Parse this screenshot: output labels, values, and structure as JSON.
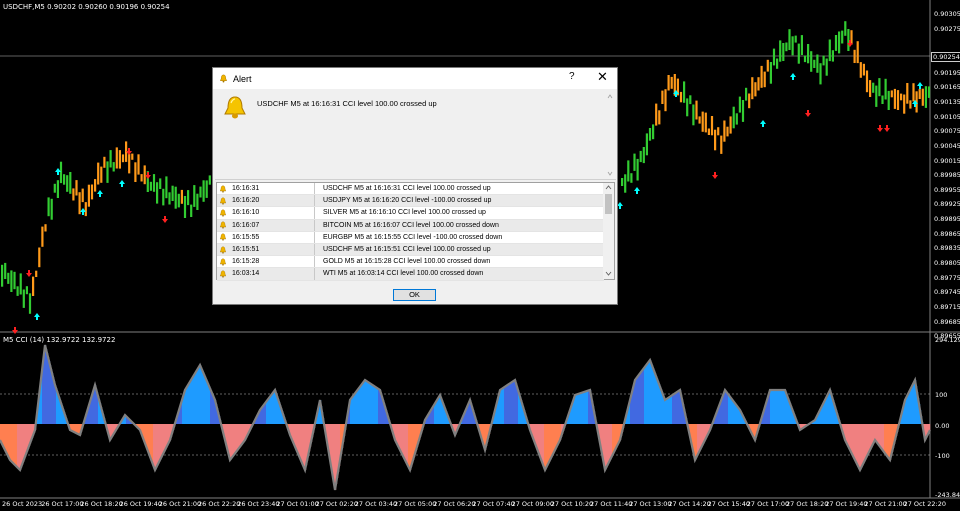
{
  "chart": {
    "symbol_header": "USDCHF,M5  0.90202 0.90260 0.90196 0.90254",
    "current_price": "0.90254",
    "price_ticks": [
      "0.90305",
      "0.90275",
      "0.90254",
      "0.90225",
      "0.90195",
      "0.90165",
      "0.90135",
      "0.90105",
      "0.90075",
      "0.90045",
      "0.90015",
      "0.89985",
      "0.89955",
      "0.89925",
      "0.89895",
      "0.89865",
      "0.89835",
      "0.89805",
      "0.89775",
      "0.89745",
      "0.89715",
      "0.89685",
      "0.89655"
    ],
    "indicator_header": "M5 CCI (14) 132.9722 132.9722",
    "cci_ticks": [
      "294.1291",
      "100",
      "0.00",
      "-100",
      "-243.843"
    ],
    "time_ticks": [
      "26 Oct 2023",
      "26 Oct 17:00",
      "26 Oct 18:20",
      "26 Oct 19:40",
      "26 Oct 21:00",
      "26 Oct 22:20",
      "26 Oct 23:40",
      "27 Oct 01:00",
      "27 Oct 02:20",
      "27 Oct 03:40",
      "27 Oct 05:00",
      "27 Oct 06:20",
      "27 Oct 07:40",
      "27 Oct 09:00",
      "27 Oct 10:20",
      "27 Oct 11:40",
      "27 Oct 13:00",
      "27 Oct 14:20",
      "27 Oct 15:40",
      "27 Oct 17:00",
      "27 Oct 18:20",
      "27 Oct 19:40",
      "27 Oct 21:00",
      "27 Oct 22:20"
    ],
    "colors": {
      "bull": "#32cd32",
      "bear": "#ff9a1a",
      "up_arrow": "#00ffff",
      "down_arrow": "#ff2020",
      "cci_pos": "#1e9bff",
      "cci_pos_dark": "#4169e1",
      "cci_neg": "#f08080",
      "cci_neg_alt": "#ff7f50",
      "cci_line": "#808080"
    }
  },
  "dialog": {
    "title": "Alert",
    "help": "?",
    "close": "✕",
    "message": "USDCHF  M5 at 16:16:31 CCI level 100.00 crossed up",
    "rows": [
      {
        "time": "16:16:31",
        "msg": "USDCHF  M5 at 16:16:31 CCI level 100.00 crossed up"
      },
      {
        "time": "16:16:20",
        "msg": "USDJPY  M5 at 16:16:20 CCI level -100.00 crossed up"
      },
      {
        "time": "16:16:10",
        "msg": "SILVER  M5 at 16:16:10 CCI level 100.00 crossed up"
      },
      {
        "time": "16:16:07",
        "msg": "BITCOIN  M5 at 16:16:07 CCI level 100.00 crossed down"
      },
      {
        "time": "16:15:55",
        "msg": "EURGBP  M5 at 16:15:55 CCI level -100.00 crossed down"
      },
      {
        "time": "16:15:51",
        "msg": "USDCHF  M5 at 16:15:51 CCI level 100.00 crossed up"
      },
      {
        "time": "16:15:28",
        "msg": "GOLD  M5 at 16:15:28 CCI level 100.00 crossed down"
      },
      {
        "time": "16:03:14",
        "msg": "WTI  M5 at 16:03:14 CCI level 100.00 crossed down"
      }
    ],
    "ok_label": "OK"
  }
}
